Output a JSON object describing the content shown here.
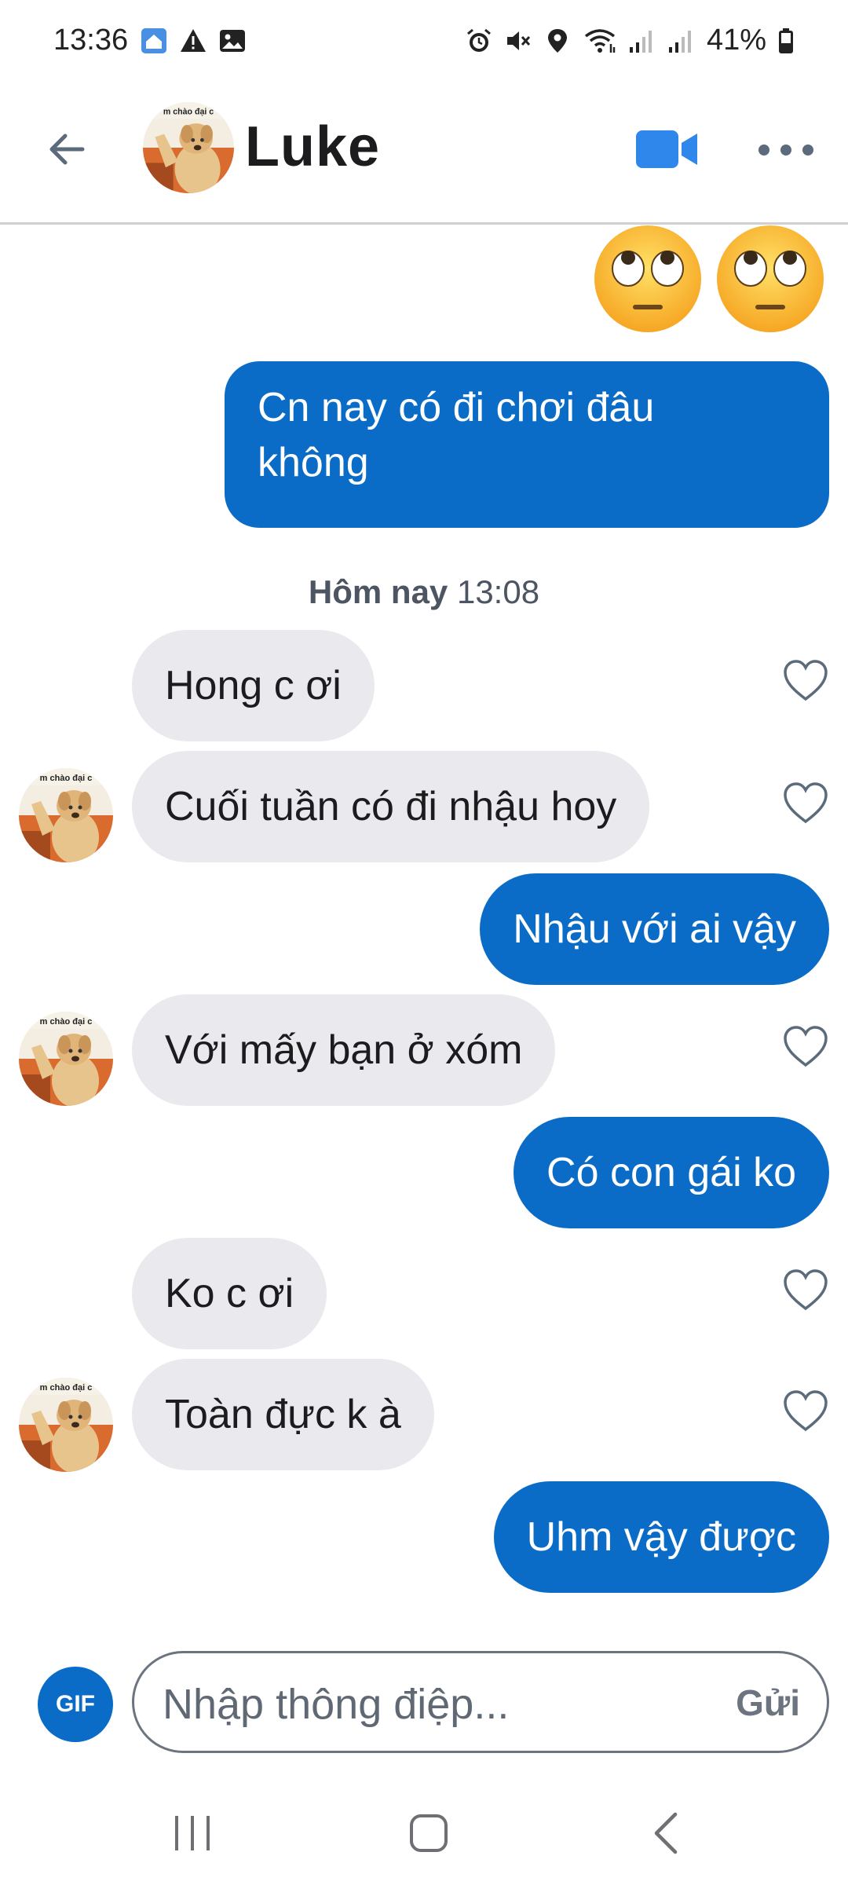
{
  "status_bar": {
    "time": "13:36",
    "battery": "41%"
  },
  "header": {
    "contact_name": "Luke",
    "avatar_caption": "m chào đại c"
  },
  "timestamp": {
    "day": "Hôm nay",
    "time": "13:08"
  },
  "messages": [
    {
      "dir": "out",
      "text": "Cn nay có đi chơi đâu"
    },
    {
      "dir": "out",
      "text": "không"
    },
    {
      "dir": "in",
      "text": "Hong c ơi"
    },
    {
      "dir": "in",
      "text": "Cuối tuần có đi nhậu hoy"
    },
    {
      "dir": "out",
      "text": "Nhậu với ai vậy"
    },
    {
      "dir": "in",
      "text": "Với mấy bạn ở xóm"
    },
    {
      "dir": "out",
      "text": "Có con gái ko"
    },
    {
      "dir": "in",
      "text": "Ko c ơi"
    },
    {
      "dir": "in",
      "text": "Toàn đực k à"
    },
    {
      "dir": "out",
      "text": "Uhm vậy được"
    }
  ],
  "composer": {
    "gif_label": "GIF",
    "placeholder": "Nhập thông điệp...",
    "send_label": "Gửi"
  },
  "colors": {
    "accent": "#0a6cc6",
    "incoming_bubble": "#e9e9ee",
    "text_muted": "#4c5561"
  },
  "icons": [
    "back-arrow-icon",
    "video-camera-icon",
    "more-dots-icon",
    "heart-outline-icon",
    "rolling-eyes-emoji",
    "alarm-icon",
    "mute-icon",
    "location-icon",
    "wifi-icon",
    "signal-icon",
    "battery-icon"
  ]
}
